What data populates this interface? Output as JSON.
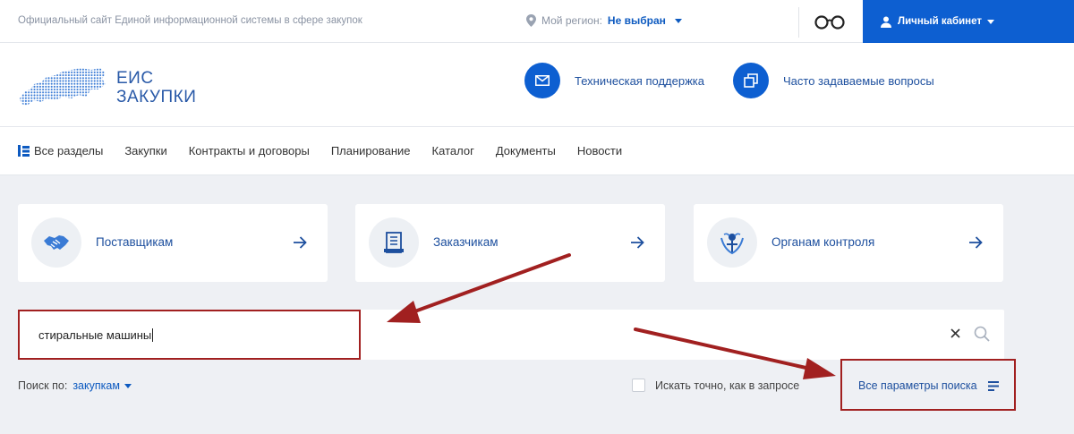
{
  "topbar": {
    "site_description": "Официальный сайт Единой информационной системы в сфере закупок",
    "region_label": "Мой регион:",
    "region_value": "Не выбран",
    "cabinet_label": "Личный кабинет"
  },
  "header": {
    "logo_line1": "ЕИС",
    "logo_line2": "ЗАКУПКИ",
    "support_label": "Техническая поддержка",
    "faq_label": "Часто задаваемые вопросы"
  },
  "nav": {
    "items": [
      {
        "label": "Все разделы"
      },
      {
        "label": "Закупки"
      },
      {
        "label": "Контракты и договоры"
      },
      {
        "label": "Планирование"
      },
      {
        "label": "Каталог"
      },
      {
        "label": "Документы"
      },
      {
        "label": "Новости"
      }
    ]
  },
  "cards": [
    {
      "label": "Поставщикам",
      "icon": "handshake-icon"
    },
    {
      "label": "Заказчикам",
      "icon": "document-icon"
    },
    {
      "label": "Органам контроля",
      "icon": "emblem-icon"
    }
  ],
  "search": {
    "query": "стиральные машины",
    "search_by_label": "Поиск по:",
    "search_by_value": "закупкам",
    "exact_label": "Искать точно, как в запросе",
    "exact_checked": false,
    "all_params_label": "Все параметры поиска"
  },
  "colors": {
    "brand_blue": "#0d5fd1",
    "link_blue": "#1d4f9e",
    "annotation_red": "#a12020",
    "page_bg": "#eef0f4"
  }
}
